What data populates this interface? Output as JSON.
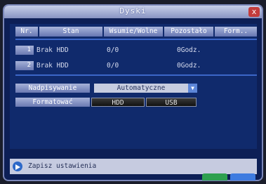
{
  "window": {
    "title": "Dyski",
    "close_label": "x"
  },
  "table": {
    "headers": [
      "Nr.",
      "Stan",
      "Wsumie/Wolne",
      "Pozostało",
      "Form.."
    ],
    "rows": [
      {
        "nr": "1",
        "stan": "Brak HDD",
        "size": "0/0",
        "remaining": "0Godz."
      },
      {
        "nr": "2",
        "stan": "Brak HDD",
        "size": "0/0",
        "remaining": "0Godz."
      }
    ]
  },
  "overwrite": {
    "label": "Nadpisywanie",
    "value": "Automatyczne"
  },
  "format": {
    "label": "Formatować",
    "hdd_label": "HDD",
    "usb_label": "USB"
  },
  "status": {
    "text": "Zapisz ustawienia"
  },
  "colors": {
    "accent": "#3c66c8",
    "background": "#0d1f56",
    "close": "#c33c3c"
  }
}
